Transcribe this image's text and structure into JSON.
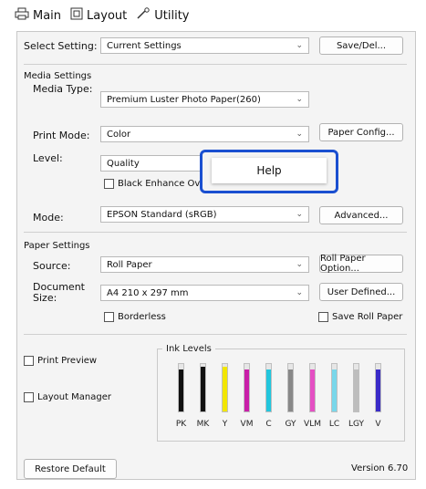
{
  "tabs": [
    {
      "label": "Main",
      "icon": "printer-icon"
    },
    {
      "label": "Layout",
      "icon": "layout-icon"
    },
    {
      "label": "Utility",
      "icon": "wrench-icon"
    }
  ],
  "select_setting": {
    "label": "Select Setting:",
    "value": "Current Settings",
    "button": "Save/Del..."
  },
  "media": {
    "title": "Media Settings",
    "media_type_label": "Media Type:",
    "media_type_value": "Premium Luster Photo Paper(260)",
    "print_mode_label": "Print Mode:",
    "print_mode_value": "Color",
    "paper_config_button": "Paper Config...",
    "level_label": "Level:",
    "level_value": "Quality",
    "black_enhance_label": "Black Enhance Over",
    "mode_label": "Mode:",
    "mode_value": "EPSON Standard (sRGB)",
    "advanced_button": "Advanced..."
  },
  "paper": {
    "title": "Paper Settings",
    "source_label": "Source:",
    "source_value": "Roll Paper",
    "roll_option_button": "Roll Paper Option...",
    "doc_size_label_1": "Document",
    "doc_size_label_2": "Size:",
    "doc_size_value": "A4 210 x 297 mm",
    "user_defined_button": "User Defined...",
    "borderless_label": "Borderless",
    "save_roll_label": "Save Roll Paper"
  },
  "print_preview_label": "Print Preview",
  "layout_manager_label": "Layout Manager",
  "ink": {
    "title": "Ink Levels",
    "inks": [
      {
        "name": "PK",
        "color": "#111111",
        "level": 0.85
      },
      {
        "name": "MK",
        "color": "#111111",
        "level": 0.9
      },
      {
        "name": "Y",
        "color": "#f2e600",
        "level": 0.9
      },
      {
        "name": "VM",
        "color": "#c81fa8",
        "level": 0.85
      },
      {
        "name": "C",
        "color": "#22c6dd",
        "level": 0.85
      },
      {
        "name": "GY",
        "color": "#888888",
        "level": 0.85
      },
      {
        "name": "VLM",
        "color": "#e44fc3",
        "level": 0.85
      },
      {
        "name": "LC",
        "color": "#79d7ea",
        "level": 0.85
      },
      {
        "name": "LGY",
        "color": "#bdbdbd",
        "level": 0.85
      },
      {
        "name": "V",
        "color": "#3a2bc8",
        "level": 0.85
      }
    ]
  },
  "restore_default_button": "Restore Default",
  "version": "Version 6.70",
  "context_menu": {
    "help_label": "Help"
  }
}
